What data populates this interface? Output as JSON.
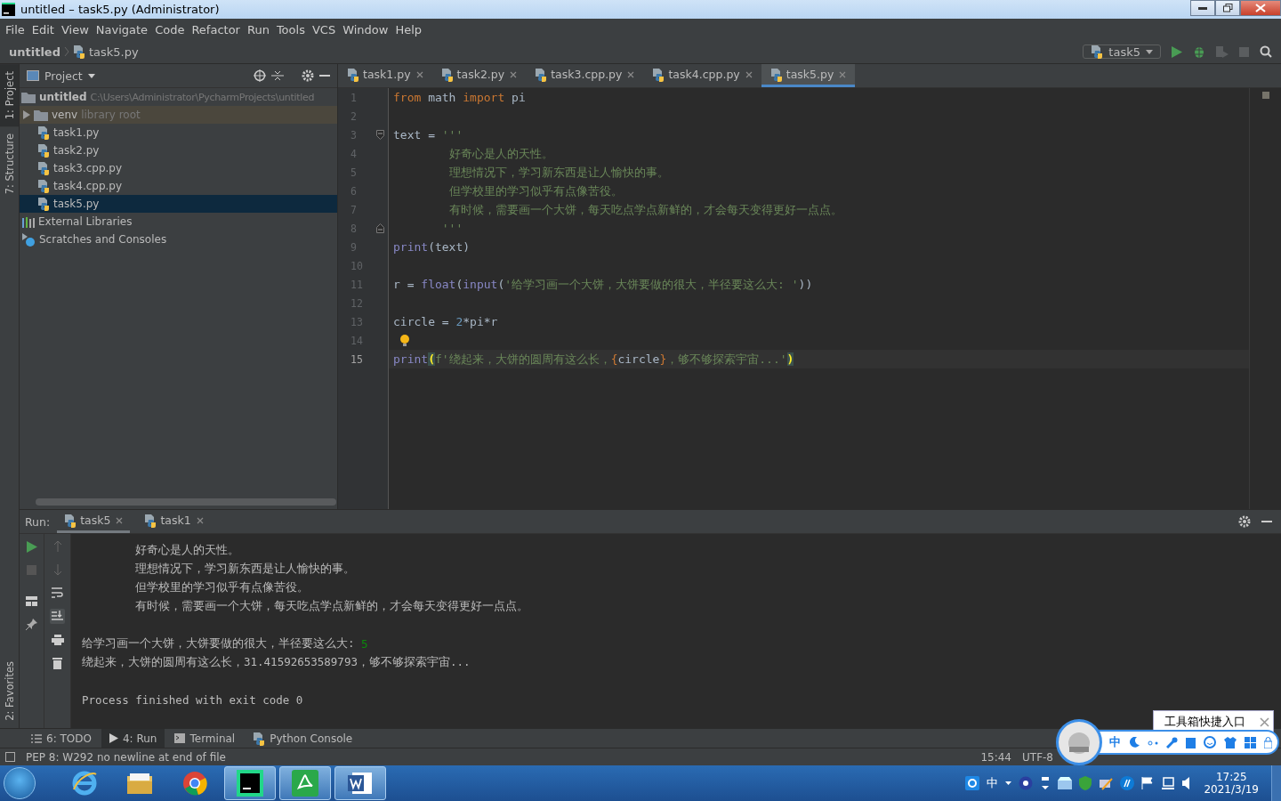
{
  "window": {
    "title": "untitled – task5.py (Administrator)"
  },
  "menu": [
    "File",
    "Edit",
    "View",
    "Navigate",
    "Code",
    "Refactor",
    "Run",
    "Tools",
    "VCS",
    "Window",
    "Help"
  ],
  "breadcrumb": [
    "untitled",
    "task5.py"
  ],
  "run_config": {
    "label": "task5"
  },
  "side_tabs": [
    {
      "label": "1: Project",
      "selected": true
    },
    {
      "label": "7: Structure",
      "selected": false
    }
  ],
  "favorites_tab": {
    "label": "2: Favorites"
  },
  "project_panel": {
    "title": "Project",
    "tree": [
      {
        "label": "untitled",
        "path": "C:\\Users\\Administrator\\PycharmProjects\\untitled",
        "kind": "folder",
        "selected": false,
        "children": [
          {
            "label": "venv",
            "note": "library root",
            "kind": "library",
            "expanded": false,
            "selected": false
          },
          {
            "label": "task1.py",
            "kind": "py",
            "selected": false
          },
          {
            "label": "task2.py",
            "kind": "py",
            "selected": false
          },
          {
            "label": "task3.cpp.py",
            "kind": "py",
            "selected": false
          },
          {
            "label": "task4.cpp.py",
            "kind": "py",
            "selected": false
          },
          {
            "label": "task5.py",
            "kind": "py",
            "selected": true
          }
        ]
      },
      {
        "label": "External Libraries",
        "kind": "libraries",
        "selected": false
      },
      {
        "label": "Scratches and Consoles",
        "kind": "scratches",
        "selected": false
      }
    ]
  },
  "editor_tabs": [
    {
      "label": "task1.py",
      "selected": false
    },
    {
      "label": "task2.py",
      "selected": false
    },
    {
      "label": "task3.cpp.py",
      "selected": false
    },
    {
      "label": "task4.cpp.py",
      "selected": false
    },
    {
      "label": "task5.py",
      "selected": true
    }
  ],
  "code_lines": [
    {
      "number": "1",
      "current": false,
      "bulb": false,
      "tokens": [
        {
          "kind": "kw",
          "text": "from"
        },
        {
          "kind": "plain",
          "text": " math "
        },
        {
          "kind": "kw",
          "text": "import"
        },
        {
          "kind": "plain",
          "text": " pi"
        }
      ]
    },
    {
      "number": "2",
      "current": false,
      "bulb": false
    },
    {
      "number": "3",
      "current": false,
      "bulb": false,
      "kind": "fold_start",
      "tokens": [
        {
          "kind": "plain",
          "text": "text = "
        },
        {
          "kind": "str",
          "text": "'''"
        }
      ]
    },
    {
      "number": "4",
      "current": false,
      "bulb": false,
      "tokens": [
        {
          "kind": "str",
          "text": "        好奇心是人的天性。"
        }
      ]
    },
    {
      "number": "5",
      "current": false,
      "bulb": false,
      "tokens": [
        {
          "kind": "str",
          "text": "        理想情况下，学习新东西是让人愉快的事。"
        }
      ]
    },
    {
      "number": "6",
      "current": false,
      "bulb": false,
      "tokens": [
        {
          "kind": "str",
          "text": "        但学校里的学习似乎有点像苦役。"
        }
      ]
    },
    {
      "number": "7",
      "current": false,
      "bulb": false,
      "tokens": [
        {
          "kind": "str",
          "text": "        有时候，需要画一个大饼，每天吃点学点新鲜的，才会每天变得更好一点点。"
        }
      ]
    },
    {
      "number": "8",
      "current": false,
      "bulb": false,
      "kind": "fold_end",
      "tokens": [
        {
          "kind": "str",
          "text": "       '''"
        }
      ]
    },
    {
      "number": "9",
      "current": false,
      "bulb": false,
      "tokens": [
        {
          "kind": "builtin",
          "text": "print"
        },
        {
          "kind": "plain",
          "text": "(text)"
        }
      ]
    },
    {
      "number": "10",
      "current": false,
      "bulb": false
    },
    {
      "number": "11",
      "current": false,
      "bulb": false,
      "tokens": [
        {
          "kind": "plain",
          "text": "r = "
        },
        {
          "kind": "builtin",
          "text": "float"
        },
        {
          "kind": "plain",
          "text": "("
        },
        {
          "kind": "builtin",
          "text": "input"
        },
        {
          "kind": "plain",
          "text": "("
        },
        {
          "kind": "str",
          "text": "'给学习画一个大饼，大饼要做的很大，半径要这么大: '"
        },
        {
          "kind": "plain",
          "text": "))"
        }
      ]
    },
    {
      "number": "12",
      "current": false,
      "bulb": false
    },
    {
      "number": "13",
      "current": false,
      "bulb": false,
      "tokens": [
        {
          "kind": "plain",
          "text": "circle = "
        },
        {
          "kind": "num",
          "text": "2"
        },
        {
          "kind": "plain",
          "text": "*pi*r"
        }
      ]
    },
    {
      "number": "14",
      "current": false,
      "bulb": true
    },
    {
      "number": "15",
      "current": true,
      "bulb": false,
      "tokens": [
        {
          "kind": "builtin",
          "text": "print"
        },
        {
          "kind": "match",
          "text": "("
        },
        {
          "kind": "str",
          "text": "f'绕起来，大饼的圆周有这么长，"
        },
        {
          "kind": "brace",
          "text": "{"
        },
        {
          "kind": "plain",
          "text": "circle"
        },
        {
          "kind": "brace",
          "text": "}"
        },
        {
          "kind": "str",
          "text": "，够不够探索宇宙...'"
        },
        {
          "kind": "match",
          "text": ")"
        }
      ]
    }
  ],
  "run_panel": {
    "label": "Run:",
    "tabs": [
      {
        "label": "task5",
        "selected": true
      },
      {
        "label": "task1",
        "selected": false
      }
    ],
    "output": [
      {
        "kind": "text",
        "text": "        好奇心是人的天性。"
      },
      {
        "kind": "text",
        "text": "        理想情况下，学习新东西是让人愉快的事。"
      },
      {
        "kind": "text",
        "text": "        但学校里的学习似乎有点像苦役。"
      },
      {
        "kind": "text",
        "text": "        有时候，需要画一个大饼，每天吃点学点新鲜的，才会每天变得更好一点点。"
      },
      {
        "kind": "prompt",
        "text": "给学习画一个大饼，大饼要做的很大，半径要这么大:",
        "input": "5"
      },
      {
        "kind": "text",
        "text": "绕起来，大饼的圆周有这么长，31.41592653589793，够不够探索宇宙..."
      },
      {
        "kind": "exit",
        "text": "Process finished with exit code 0"
      }
    ]
  },
  "tool_tabs": [
    {
      "label": "6: TODO",
      "kind": "todo",
      "selected": false
    },
    {
      "label": "4: Run",
      "kind": "run",
      "selected": true
    },
    {
      "label": "Terminal",
      "kind": "terminal",
      "selected": false
    },
    {
      "label": "Python Console",
      "kind": "python",
      "selected": false
    }
  ],
  "status_bar": {
    "message": "PEP 8: W292 no newline at end of file",
    "position": "15:44",
    "encoding": "UTF-8"
  },
  "ime_bar": {
    "tooltip": "工具箱快捷入口",
    "mode": "中"
  },
  "taskbar": {
    "apps": [
      {
        "kind": "ie",
        "selected": false
      },
      {
        "kind": "explorer",
        "selected": false
      },
      {
        "kind": "chrome",
        "selected": false
      },
      {
        "kind": "pycharm",
        "selected": true
      },
      {
        "kind": "pdf",
        "selected": true
      },
      {
        "kind": "word",
        "selected": true
      }
    ],
    "ime": "中",
    "time": "17:25",
    "date": "2021/3/19"
  }
}
